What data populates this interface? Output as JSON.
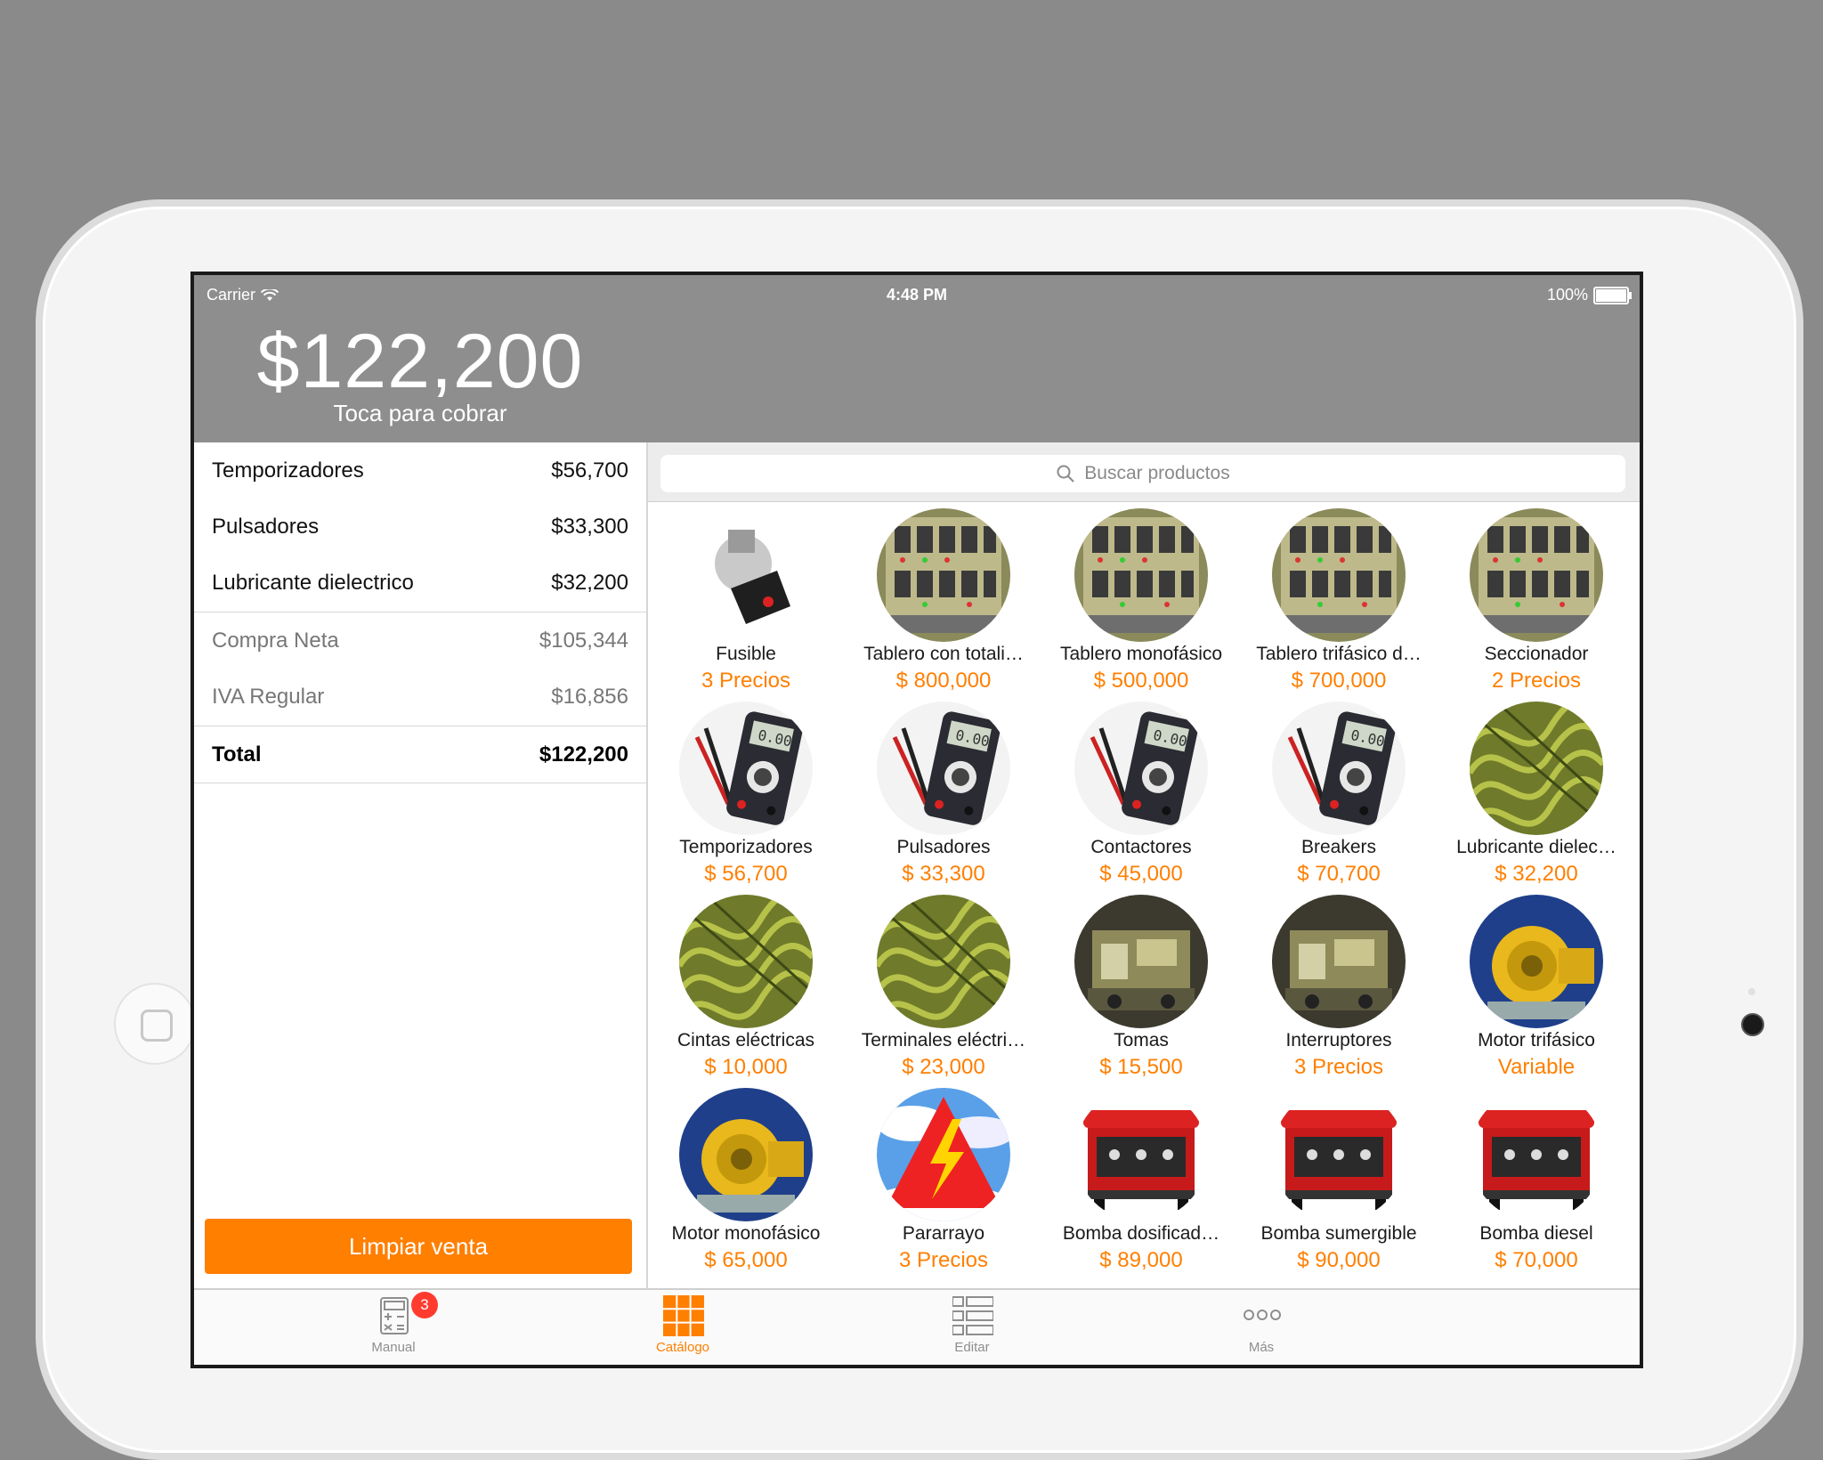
{
  "status_bar": {
    "carrier": "Carrier",
    "time": "4:48 PM",
    "battery": "100%"
  },
  "sale": {
    "total": "$122,200",
    "subtitle": "Toca para cobrar"
  },
  "cart": {
    "items": [
      {
        "name": "Temporizadores",
        "amount": "$56,700"
      },
      {
        "name": "Pulsadores",
        "amount": "$33,300"
      },
      {
        "name": "Lubricante dielectrico",
        "amount": "$32,200"
      }
    ],
    "summary": [
      {
        "label": "Compra Neta",
        "amount": "$105,344"
      },
      {
        "label": "IVA Regular",
        "amount": "$16,856"
      }
    ],
    "total": {
      "label": "Total",
      "amount": "$122,200"
    },
    "clear_button": "Limpiar venta"
  },
  "search": {
    "placeholder": "Buscar productos"
  },
  "products": [
    {
      "name": "Fusible",
      "price": "3 Precios",
      "image": "fuse"
    },
    {
      "name": "Tablero con totali…",
      "price": "$ 800,000",
      "image": "panel"
    },
    {
      "name": "Tablero monofásico",
      "price": "$ 500,000",
      "image": "panel"
    },
    {
      "name": "Tablero trifásico d…",
      "price": "$ 700,000",
      "image": "panel"
    },
    {
      "name": "Seccionador",
      "price": "2 Precios",
      "image": "panel"
    },
    {
      "name": "Temporizadores",
      "price": "$ 56,700",
      "image": "multimeter"
    },
    {
      "name": "Pulsadores",
      "price": "$ 33,300",
      "image": "multimeter"
    },
    {
      "name": "Contactores",
      "price": "$ 45,000",
      "image": "multimeter"
    },
    {
      "name": "Breakers",
      "price": "$ 70,700",
      "image": "multimeter"
    },
    {
      "name": "Lubricante dielec…",
      "price": "$ 32,200",
      "image": "coil"
    },
    {
      "name": "Cintas eléctricas",
      "price": "$ 10,000",
      "image": "coil"
    },
    {
      "name": "Terminales eléctri…",
      "price": "$ 23,000",
      "image": "coil"
    },
    {
      "name": "Tomas",
      "price": "$ 15,500",
      "image": "machine"
    },
    {
      "name": "Interruptores",
      "price": "3 Precios",
      "image": "machine"
    },
    {
      "name": "Motor trifásico",
      "price": "Variable",
      "image": "motor"
    },
    {
      "name": "Motor monofásico",
      "price": "$ 65,000",
      "image": "motor"
    },
    {
      "name": "Pararrayo",
      "price": "3 Precios",
      "image": "lightning"
    },
    {
      "name": "Bomba dosificad…",
      "price": "$ 89,000",
      "image": "generator"
    },
    {
      "name": "Bomba sumergible",
      "price": "$ 90,000",
      "image": "generator"
    },
    {
      "name": "Bomba diesel",
      "price": "$ 70,000",
      "image": "generator"
    }
  ],
  "tabs": [
    {
      "label": "Manual",
      "badge": "3",
      "icon": "calculator-icon"
    },
    {
      "label": "Catálogo",
      "icon": "grid-icon",
      "active": true
    },
    {
      "label": "Editar",
      "icon": "list-icon"
    },
    {
      "label": "Más",
      "icon": "more-icon"
    }
  ],
  "colors": {
    "accent": "#ff7f00",
    "header": "#8e8e8e",
    "badge": "#ff3b30"
  }
}
